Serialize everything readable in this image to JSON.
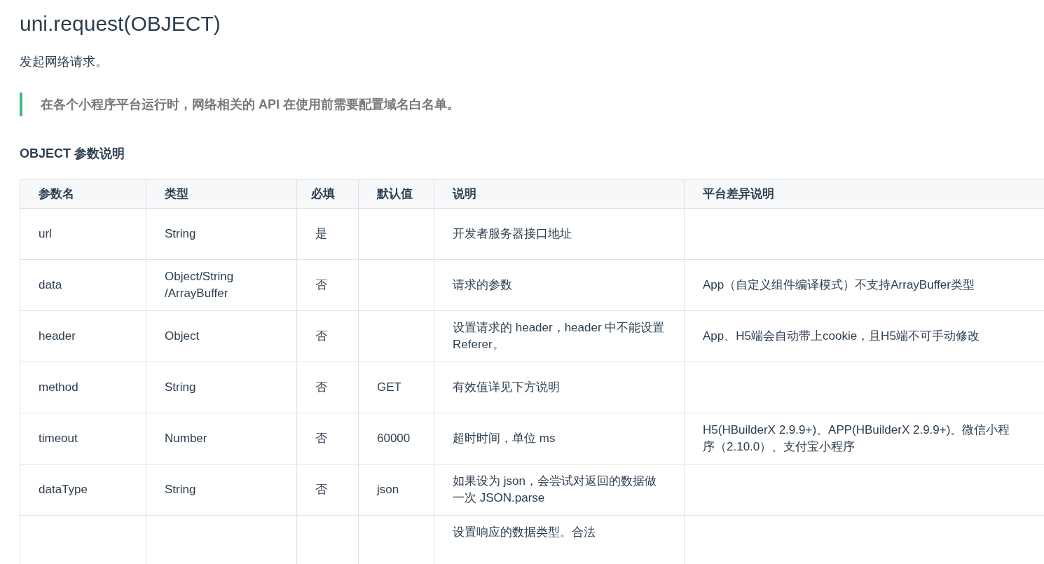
{
  "title": "uni.request(OBJECT)",
  "intro": "发起网络请求。",
  "note": "在各个小程序平台运行时，网络相关的 API 在使用前需要配置域名白名单。",
  "section_heading": "OBJECT 参数说明",
  "table": {
    "columns": [
      "参数名",
      "类型",
      "必填",
      "默认值",
      "说明",
      "平台差异说明"
    ],
    "rows": [
      {
        "name": "url",
        "type": "String",
        "required": "是",
        "description": "开发者服务器接口地址"
      },
      {
        "name": "data",
        "type": "Object/String\n/ArrayBuffer",
        "required": "否",
        "description": "请求的参数",
        "platform_notes": "App（自定义组件编译模式）不支持ArrayBuffer类型"
      },
      {
        "name": "header",
        "type": "Object",
        "required": "否",
        "description": "设置请求的 header，header 中不能设置 Referer。",
        "platform_notes": "App、H5端会自动带上cookie，且H5端不可手动修改"
      },
      {
        "name": "method",
        "type": "String",
        "required": "否",
        "default": "GET",
        "description": "有效值详见下方说明"
      },
      {
        "name": "timeout",
        "type": "Number",
        "required": "否",
        "default": "60000",
        "description": "超时时间，单位 ms",
        "platform_notes": "H5(HBuilderX 2.9.9+)、APP(HBuilderX 2.9.9+)、微信小程序（2.10.0）、支付宝小程序"
      },
      {
        "name": "dataType",
        "type": "String",
        "required": "否",
        "default": "json",
        "description": "如果设为 json，会尝试对返回的数据做一次 JSON.parse"
      },
      {
        "description": "设置响应的数据类型。合法"
      }
    ]
  }
}
